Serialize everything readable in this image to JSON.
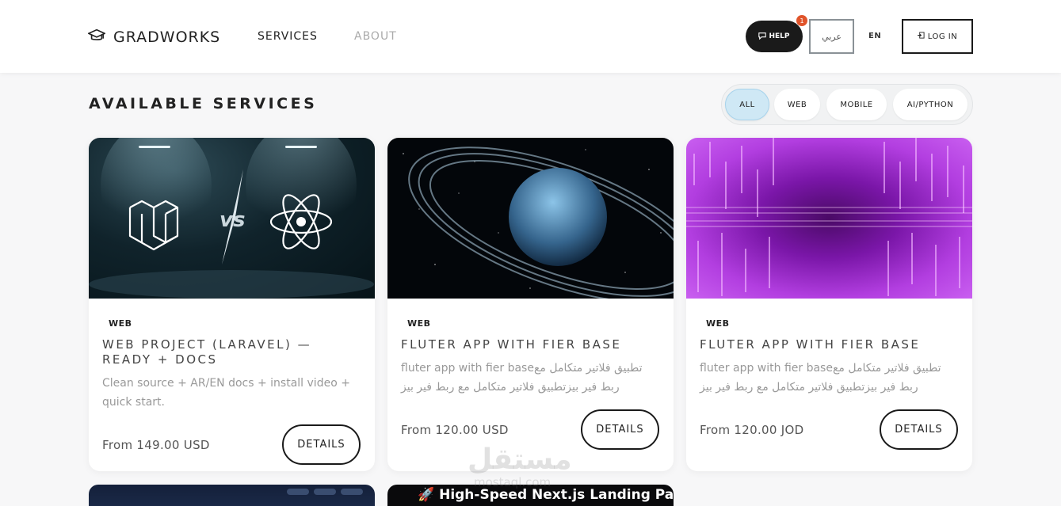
{
  "header": {
    "brand": "GRADWORKS",
    "nav": {
      "services": "SERVICES",
      "about": "ABOUT"
    },
    "help_label": "HELP",
    "help_badge": "1",
    "lang_ar": "عربي",
    "lang_en": "EN",
    "login_label": "LOG IN"
  },
  "section": {
    "title": "AVAILABLE SERVICES"
  },
  "filters": [
    {
      "label": "ALL",
      "active": true
    },
    {
      "label": "WEB",
      "active": false
    },
    {
      "label": "MOBILE",
      "active": false
    },
    {
      "label": "AI/PYTHON",
      "active": false
    }
  ],
  "cards": [
    {
      "tag": "WEB",
      "title": "WEB PROJECT (LARAVEL) — READY + DOCS",
      "description": "Clean source + AR/EN docs + install video + quick start.",
      "price": "From 149.00 USD",
      "button": "DETAILS"
    },
    {
      "tag": "WEB",
      "title": "FLUTER APP WITH FIER BASE",
      "description": "fluter app with fier baseتطبيق فلاتير متكامل مع ربط فير بيزتطبيق فلاتير متكامل مع ربط فير بيز",
      "price": "From 120.00 USD",
      "button": "DETAILS"
    },
    {
      "tag": "WEB",
      "title": "FLUTER APP WITH FIER BASE",
      "description": "fluter app with fier baseتطبيق فلاتير متكامل مع ربط فير بيزتطبيق فلاتير متكامل مع ربط فير بيز",
      "price": "From 120.00 JOD",
      "button": "DETAILS"
    }
  ],
  "bottom_cards": [
    {
      "text": ""
    },
    {
      "text": "🚀 High-Speed Next.js Landing Pages"
    }
  ],
  "watermark": {
    "main": "مستقل",
    "sub": "mostaql.com"
  },
  "colors": {
    "accent_chip": "#cfe8f5",
    "badge": "#e0542b",
    "dark": "#1a1a1a"
  }
}
